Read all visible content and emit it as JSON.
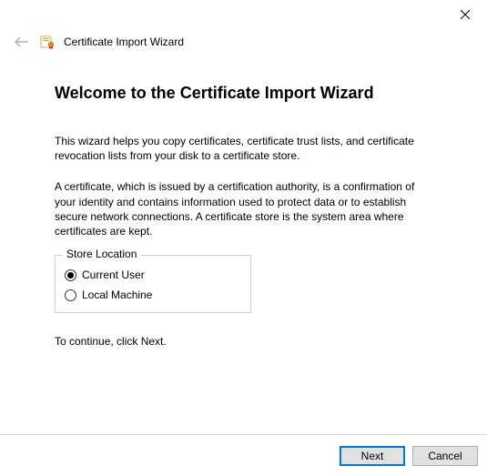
{
  "window": {
    "title": "Certificate Import Wizard"
  },
  "main": {
    "heading": "Welcome to the Certificate Import Wizard",
    "paragraph1": "This wizard helps you copy certificates, certificate trust lists, and certificate revocation lists from your disk to a certificate store.",
    "paragraph2": "A certificate, which is issued by a certification authority, is a confirmation of your identity and contains information used to protect data or to establish secure network connections. A certificate store is the system area where certificates are kept.",
    "storeLocation": {
      "legend": "Store Location",
      "options": [
        {
          "label": "Current User",
          "selected": true
        },
        {
          "label": "Local Machine",
          "selected": false
        }
      ]
    },
    "continueText": "To continue, click Next."
  },
  "buttons": {
    "next": "Next",
    "cancel": "Cancel"
  }
}
